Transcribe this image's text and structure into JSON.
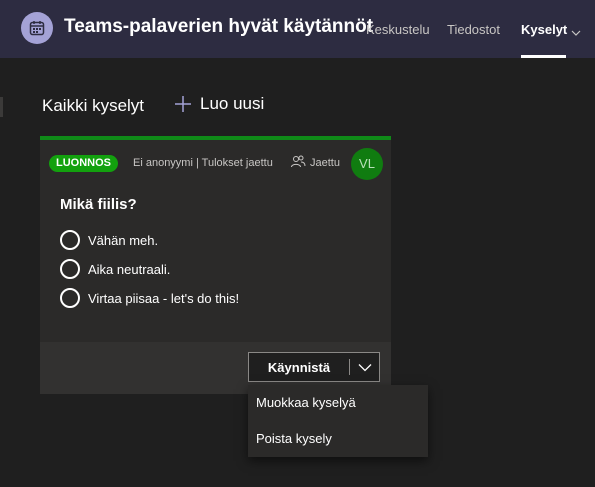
{
  "header": {
    "title": "Teams-palaverien hyvät käytännöt",
    "tabs": [
      {
        "label": "Keskustelu",
        "active": false
      },
      {
        "label": "Tiedostot",
        "active": false
      },
      {
        "label": "Kyselyt",
        "active": true
      }
    ],
    "app_icon": "calendar-icon"
  },
  "toolbar": {
    "all_polls": "Kaikki kyselyt",
    "create_new": "Luo uusi"
  },
  "poll_card": {
    "badge": "LUONNOS",
    "meta": "Ei anonyymi | Tulokset jaettu",
    "shared": "Jaettu",
    "avatar_initials": "VL",
    "question": "Mikä fiilis?",
    "options": [
      "Vähän meh.",
      "Aika neutraali.",
      "Virtaa piisaa - let's do this!"
    ],
    "start_button": "Käynnistä"
  },
  "dropdown_menu": {
    "items": [
      "Muokkaa kyselyä",
      "Poista kysely"
    ]
  },
  "colors": {
    "header_bg": "#2d2c41",
    "page_bg": "#1f1f1f",
    "card_bg": "#2b2a29",
    "draft_green": "#13a10e",
    "avatar_green": "#107c10",
    "accent_purple": "#a4a2d6"
  }
}
